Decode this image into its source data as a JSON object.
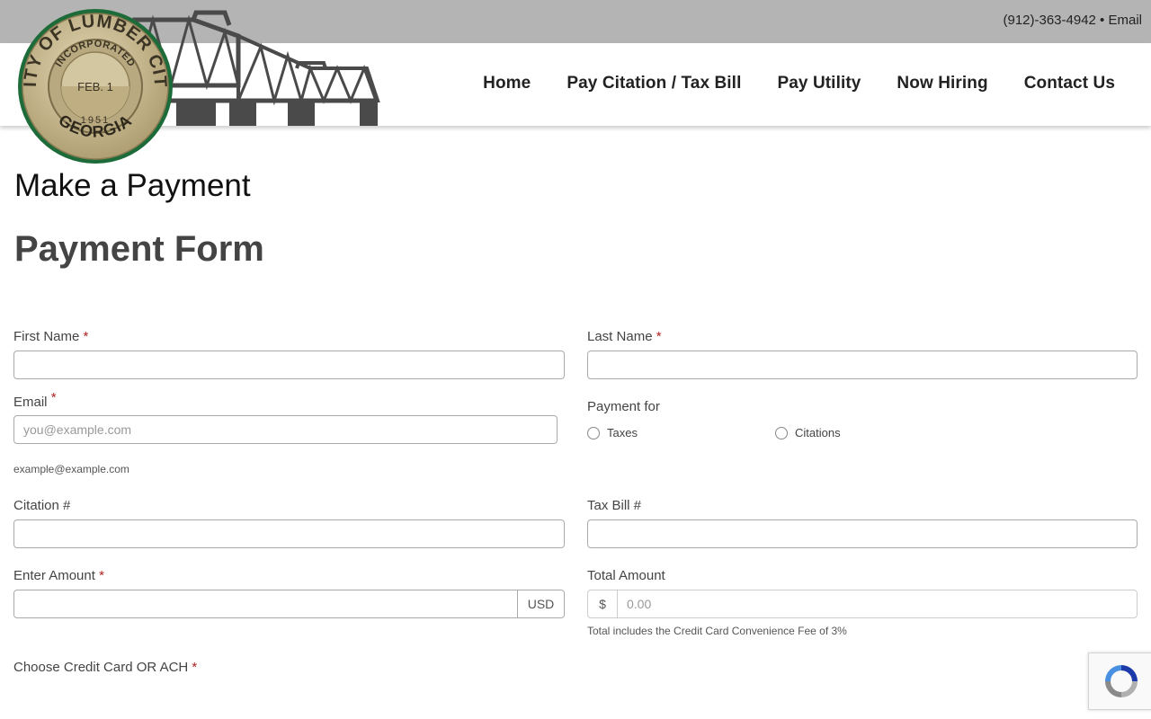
{
  "topbar": {
    "phone": "(912)-363-4942",
    "separator": " • ",
    "email_label": "Email"
  },
  "seal": {
    "top_text": "CITY OF LUMBER CITY",
    "ring_text": "INCORPORATED",
    "date": "FEB. 1",
    "year": "1951",
    "bottom_text": "GEORGIA"
  },
  "nav": {
    "items": [
      {
        "label": "Home"
      },
      {
        "label": "Pay Citation / Tax Bill"
      },
      {
        "label": "Pay Utility"
      },
      {
        "label": "Now Hiring"
      },
      {
        "label": "Contact Us"
      }
    ]
  },
  "page": {
    "title": "Make a Payment",
    "form_title": "Payment Form"
  },
  "form": {
    "required_mark": "*",
    "first_name": {
      "label": "First Name",
      "value": ""
    },
    "last_name": {
      "label": "Last Name",
      "value": ""
    },
    "email": {
      "label": "Email",
      "placeholder": "you@example.com",
      "hint": "example@example.com"
    },
    "payment_for": {
      "label": "Payment for",
      "options": [
        "Taxes",
        "Citations"
      ]
    },
    "citation": {
      "label": "Citation #"
    },
    "tax_bill": {
      "label": "Tax Bill #"
    },
    "amount": {
      "label": "Enter Amount",
      "currency": "USD"
    },
    "total": {
      "label": "Total Amount",
      "prefix": "$",
      "placeholder": "0.00",
      "note": "Total includes the Credit Card Convenience Fee of 3%"
    },
    "method": {
      "label": "Choose Credit Card OR ACH"
    }
  },
  "colors": {
    "seal_green": "#1e6b3a",
    "seal_gold": "#c9b98a",
    "bridge": "#4a4a4a",
    "required": "#b22222"
  }
}
